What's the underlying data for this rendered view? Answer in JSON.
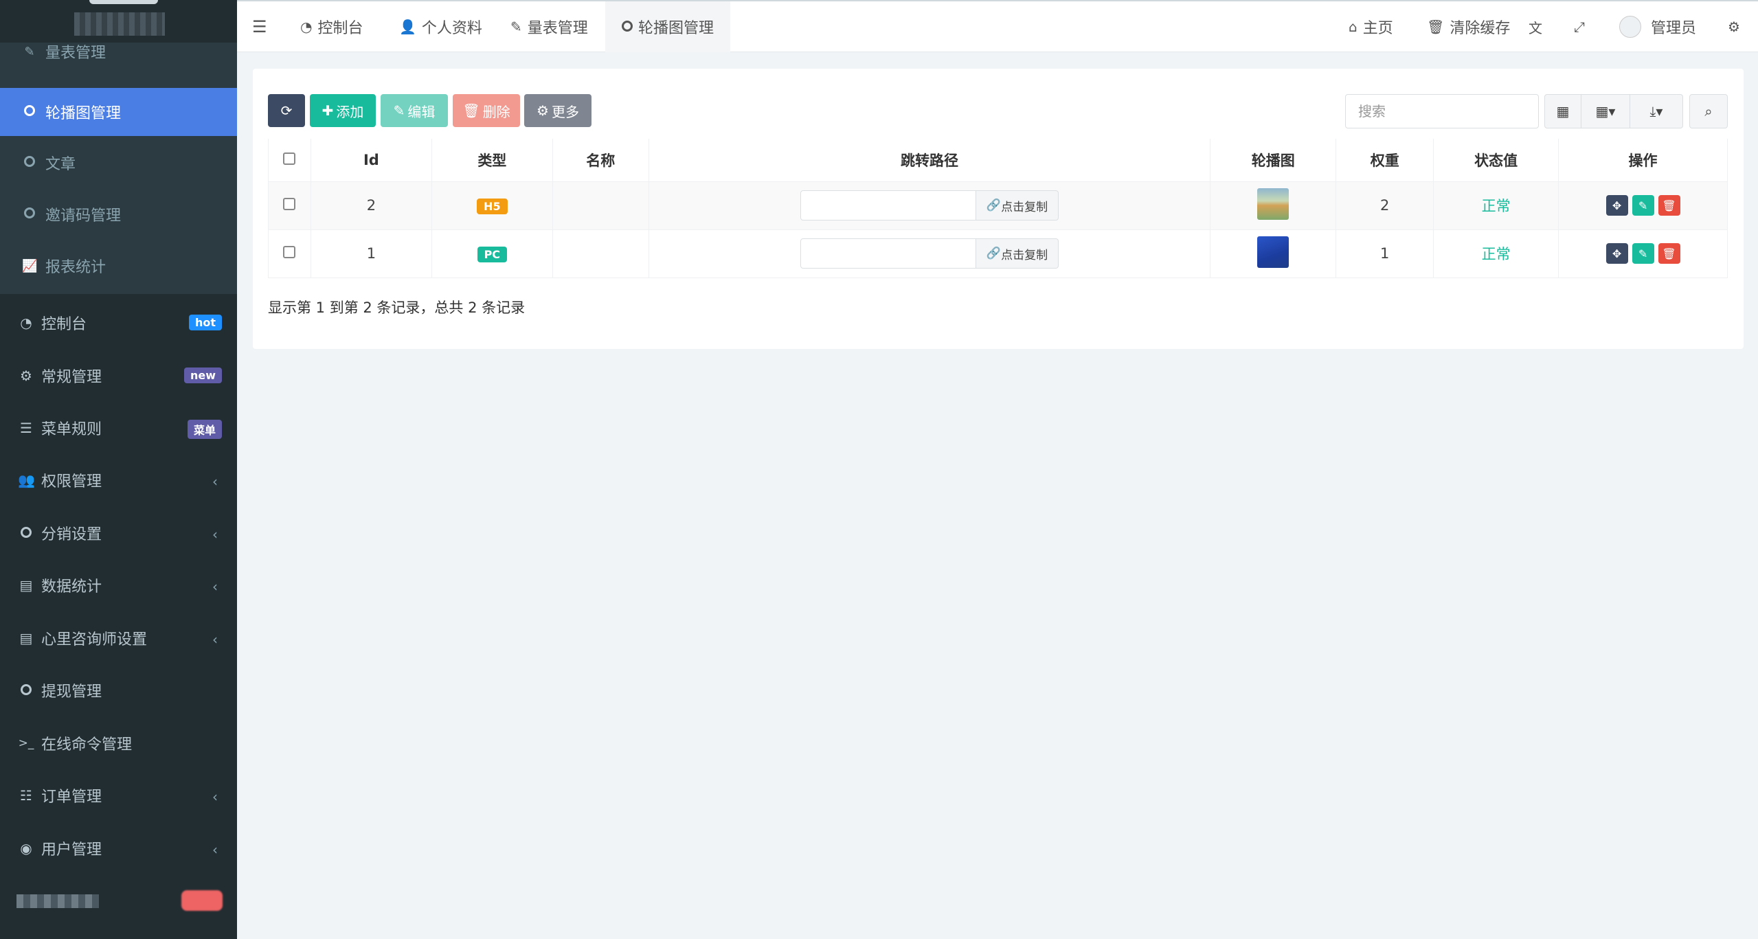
{
  "sidebar": {
    "submenu": [
      {
        "label": "量表管理",
        "icon": "edit-icon",
        "active": false
      },
      {
        "label": "轮播图管理",
        "icon": "circle-icon",
        "active": true
      },
      {
        "label": "文章",
        "icon": "circle-icon",
        "active": false
      },
      {
        "label": "邀请码管理",
        "icon": "circle-icon",
        "active": false
      },
      {
        "label": "报表统计",
        "icon": "line-chart-icon",
        "active": false
      }
    ],
    "menu": [
      {
        "label": "控制台",
        "icon": "dashboard-icon",
        "badge": "hot",
        "badge_color": "#1e90ff"
      },
      {
        "label": "常规管理",
        "icon": "cogs-icon",
        "badge": "new",
        "badge_color": "#605ca8"
      },
      {
        "label": "菜单规则",
        "icon": "bars-icon",
        "badge": "菜单",
        "badge_color": "#605ca8"
      },
      {
        "label": "权限管理",
        "icon": "users-icon",
        "chevron": "‹"
      },
      {
        "label": "分销设置",
        "icon": "circle-icon",
        "chevron": "‹"
      },
      {
        "label": "数据统计",
        "icon": "list-icon",
        "chevron": "‹"
      },
      {
        "label": "心里咨询师设置",
        "icon": "list-icon",
        "chevron": "‹"
      },
      {
        "label": "提现管理",
        "icon": "circle-icon"
      },
      {
        "label": "在线命令管理",
        "icon": "terminal-icon"
      },
      {
        "label": "订单管理",
        "icon": "server-icon",
        "chevron": "‹"
      },
      {
        "label": "用户管理",
        "icon": "user-circle-icon",
        "chevron": "‹"
      }
    ]
  },
  "topbar": {
    "tabs": [
      {
        "label": "控制台",
        "icon": "dashboard-icon"
      },
      {
        "label": "个人资料",
        "icon": "user-icon"
      },
      {
        "label": "量表管理",
        "icon": "edit-icon"
      },
      {
        "label": "轮播图管理",
        "icon": "circle-icon",
        "active": true
      }
    ],
    "right": {
      "home_label": "主页",
      "clear_cache_label": "清除缓存",
      "admin_label": "管理员"
    }
  },
  "toolbar": {
    "add_label": "添加",
    "edit_label": "编辑",
    "delete_label": "删除",
    "more_label": "更多",
    "search_placeholder": "搜索"
  },
  "table": {
    "headers": [
      "Id",
      "类型",
      "名称",
      "跳转路径",
      "轮播图",
      "权重",
      "状态值",
      "操作"
    ],
    "copy_label": "点击复制",
    "rows": [
      {
        "id": "2",
        "type": "H5",
        "type_color": "#f39c12",
        "name": "",
        "path": "",
        "weight": "2",
        "status": "正常"
      },
      {
        "id": "1",
        "type": "PC",
        "type_color": "#18bc9c",
        "name": "",
        "path": "",
        "weight": "1",
        "status": "正常"
      }
    ]
  },
  "footer": {
    "summary": "显示第 1 到第 2 条记录，总共 2 条记录"
  },
  "colors": {
    "primary": "#4a7ee4",
    "success": "#18bc9c",
    "danger": "#e74c3c",
    "dark": "#3c4a63"
  }
}
